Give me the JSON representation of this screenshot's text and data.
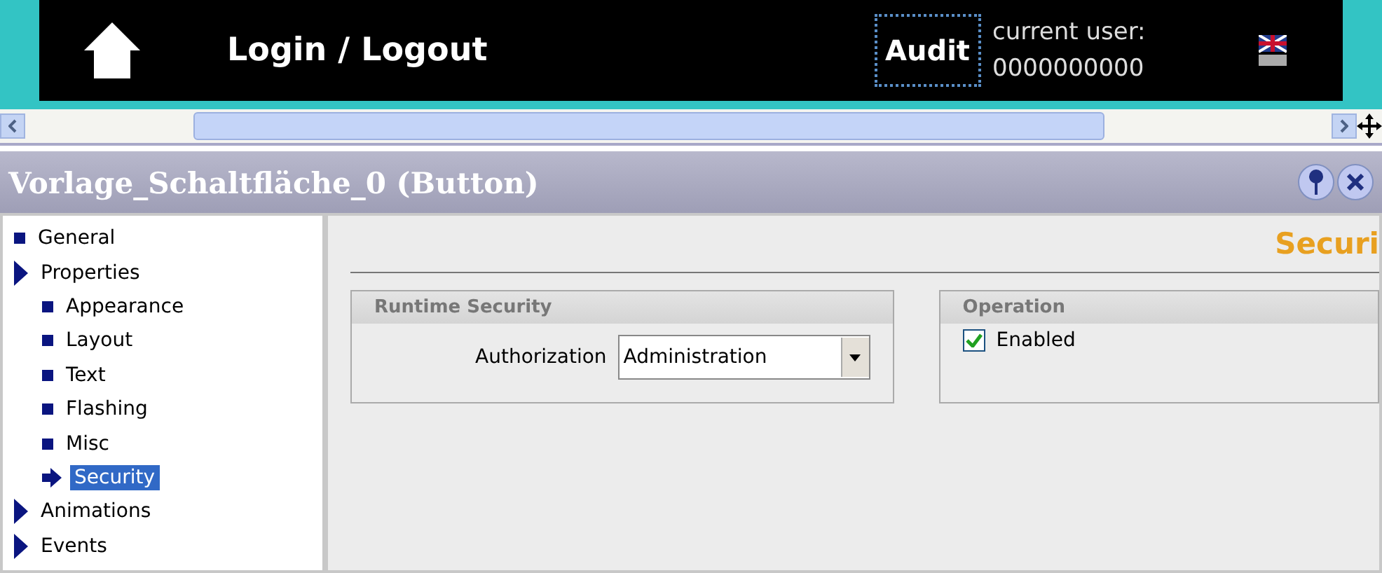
{
  "header": {
    "login": "Login / Logout",
    "audit": "Audit",
    "user_label": "current user:",
    "user_value": "0000000000"
  },
  "panel_title": "Vorlage_Schaltfläche_0 (Button)",
  "tree": [
    {
      "label": "General",
      "kind": "leaf",
      "selected": false
    },
    {
      "label": "Properties",
      "kind": "group",
      "selected": false,
      "children": [
        {
          "label": "Appearance",
          "kind": "leaf",
          "selected": false
        },
        {
          "label": "Layout",
          "kind": "leaf",
          "selected": false
        },
        {
          "label": "Text",
          "kind": "leaf",
          "selected": false
        },
        {
          "label": "Flashing",
          "kind": "leaf",
          "selected": false
        },
        {
          "label": "Misc",
          "kind": "leaf",
          "selected": false
        },
        {
          "label": "Security",
          "kind": "leaf",
          "selected": true
        }
      ]
    },
    {
      "label": "Animations",
      "kind": "group",
      "selected": false
    },
    {
      "label": "Events",
      "kind": "group",
      "selected": false
    }
  ],
  "section_heading": "Securi",
  "runtime_security": {
    "title": "Runtime Security",
    "label": "Authorization",
    "value": "Administration"
  },
  "operation": {
    "title": "Operation",
    "label": "Enabled",
    "checked": true
  }
}
